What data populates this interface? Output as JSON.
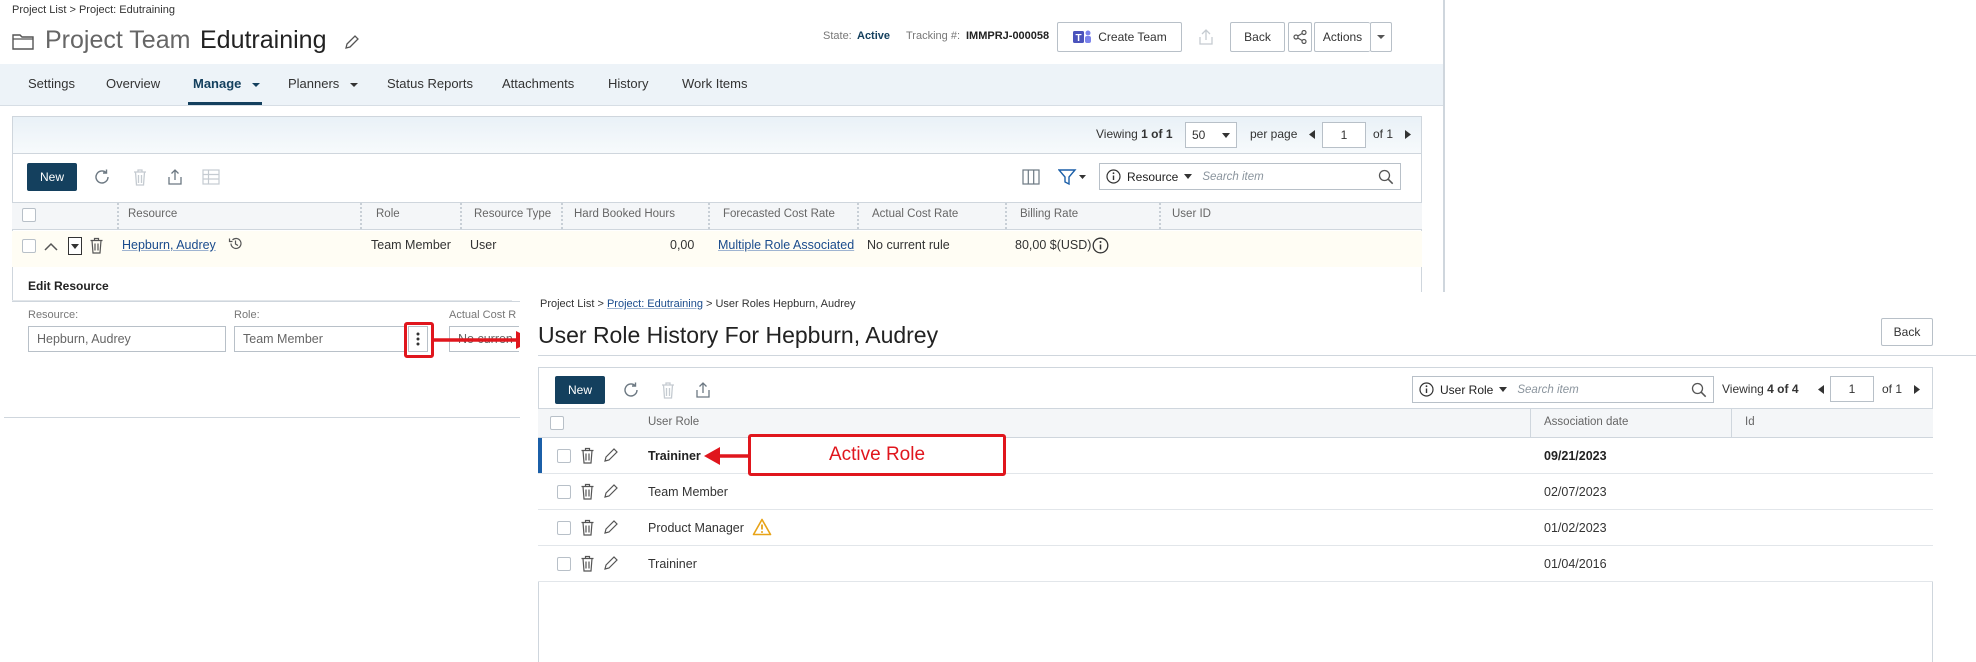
{
  "project": {
    "breadcrumb": "Project List > Project: Edutraining",
    "title_label": "Project Team",
    "title_name": "Edutraining",
    "state_label": "State:",
    "state_value": "Active",
    "tracking_label": "Tracking #:",
    "tracking_value": "IMMPRJ-000058",
    "create_team_label": "Create Team",
    "back_label": "Back",
    "actions_label": "Actions"
  },
  "tabs": [
    {
      "label": "Settings"
    },
    {
      "label": "Overview"
    },
    {
      "label": "Manage"
    },
    {
      "label": "Planners"
    },
    {
      "label": "Status Reports"
    },
    {
      "label": "Attachments"
    },
    {
      "label": "History"
    },
    {
      "label": "Work Items"
    }
  ],
  "pager": {
    "viewing_label": "Viewing",
    "viewing_range": "1 of 1",
    "per_page_value": "50",
    "per_page_label": "per page",
    "page_value": "1",
    "of_label": "of 1"
  },
  "toolbar": {
    "new_label": "New",
    "search_scope": "Resource",
    "search_placeholder": "Search item"
  },
  "resource_grid": {
    "columns": [
      "Resource",
      "Role",
      "Resource Type",
      "Hard Booked Hours",
      "Forecasted Cost Rate",
      "Actual Cost Rate",
      "Billing Rate",
      "User ID"
    ],
    "row": {
      "resource": "Hepburn, Audrey",
      "role": "Team Member",
      "resource_type": "User",
      "hard_booked_hours": "0,00",
      "forecasted_cost_rate": "Multiple Role Associated",
      "actual_cost_rate": "No current rule",
      "billing_rate": "80,00 $(USD)"
    }
  },
  "edit_resource": {
    "title": "Edit Resource",
    "resource_label": "Resource:",
    "resource_value": "Hepburn, Audrey",
    "role_label": "Role:",
    "role_value": "Team Member",
    "actual_cost_label": "Actual Cost R",
    "actual_cost_value": "No curren"
  },
  "history": {
    "breadcrumb_start": "Project List > ",
    "breadcrumb_link": "Project: Edutraining",
    "breadcrumb_end": " > User Roles Hepburn, Audrey",
    "title": "User Role History For Hepburn, Audrey",
    "back_label": "Back",
    "new_label": "New",
    "search_scope": "User Role",
    "search_placeholder": "Search item",
    "viewing_label": "Viewing",
    "viewing_range": "4 of 4",
    "page_value": "1",
    "of_label": "of 1",
    "columns": [
      "User Role",
      "Association date",
      "Id"
    ],
    "rows": [
      {
        "role": "Traininer",
        "date": "09/21/2023"
      },
      {
        "role": "Team Member",
        "date": "02/07/2023"
      },
      {
        "role": "Product Manager",
        "date": "01/02/2023"
      },
      {
        "role": "Traininer",
        "date": "01/04/2016"
      }
    ]
  },
  "annotation": {
    "label": "Active Role",
    "color": "#e0161d"
  },
  "colors": {
    "brand": "#14405e",
    "link": "#1a4b8c",
    "active_row_bar": "#1b5fa8",
    "warning": "#e8a317"
  }
}
